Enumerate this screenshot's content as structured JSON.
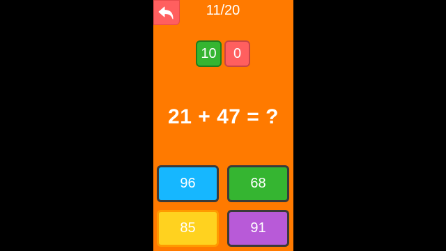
{
  "header": {
    "back_icon": "undo-arrow-icon",
    "progress": "11/20"
  },
  "score": {
    "correct": "10",
    "wrong": "0"
  },
  "question": {
    "text": "21 + 47 =  ?"
  },
  "answers": [
    {
      "label": "96",
      "color": "#16b7ff"
    },
    {
      "label": "68",
      "color": "#35b531"
    },
    {
      "label": "85",
      "color": "#ffd21f"
    },
    {
      "label": "91",
      "color": "#b85ad8"
    }
  ],
  "colors": {
    "background": "#ff7a00",
    "back_button": "#ff5f5f",
    "score_correct": "#35b531",
    "score_wrong": "#ff5f5f"
  }
}
